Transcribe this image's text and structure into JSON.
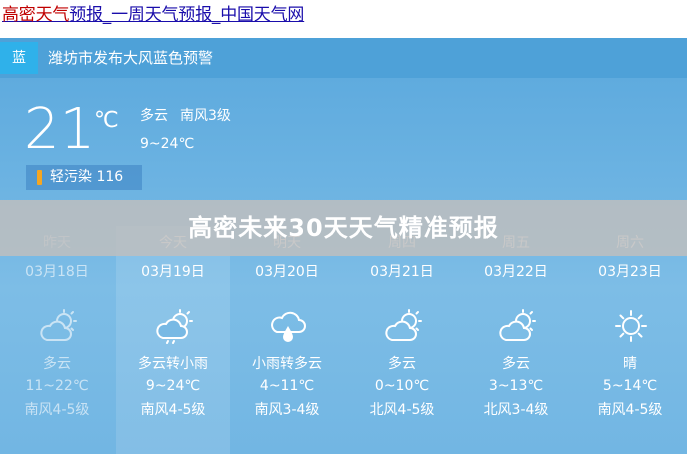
{
  "header": {
    "link_part1": "高密天气",
    "link_part2": "预报_一周天气预报_中国天气网"
  },
  "alert": {
    "tag": "蓝",
    "text": "潍坊市发布大风蓝色预警"
  },
  "current": {
    "temp": "21",
    "unit": "℃",
    "condition": "多云",
    "wind": "南风3级",
    "range": "9~24℃",
    "aqi": "轻污染 116"
  },
  "overlay_title": "高密未来30天天气精准预报",
  "forecast": [
    {
      "name": "昨天",
      "date": "03月18日",
      "icon": "partly-cloudy-icon",
      "cond": "多云",
      "range": "11~22℃",
      "wind": "南风4-5级"
    },
    {
      "name": "今天",
      "date": "03月19日",
      "icon": "cloud-rain-icon",
      "cond": "多云转小雨",
      "range": "9~24℃",
      "wind": "南风4-5级"
    },
    {
      "name": "明天",
      "date": "03月20日",
      "icon": "rain-drop-icon",
      "cond": "小雨转多云",
      "range": "4~11℃",
      "wind": "南风3-4级"
    },
    {
      "name": "周四",
      "date": "03月21日",
      "icon": "partly-cloudy-icon",
      "cond": "多云",
      "range": "0~10℃",
      "wind": "北风4-5级"
    },
    {
      "name": "周五",
      "date": "03月22日",
      "icon": "partly-cloudy-icon",
      "cond": "多云",
      "range": "3~13℃",
      "wind": "北风3-4级"
    },
    {
      "name": "周六",
      "date": "03月23日",
      "icon": "sun-icon",
      "cond": "晴",
      "range": "5~14℃",
      "wind": "南风4-5级"
    }
  ],
  "colors": {
    "link": "#1a0dab",
    "link_highlight": "#c00000",
    "alert_tag": "#2fb1ea",
    "aqi_mark": "#f5a623"
  }
}
